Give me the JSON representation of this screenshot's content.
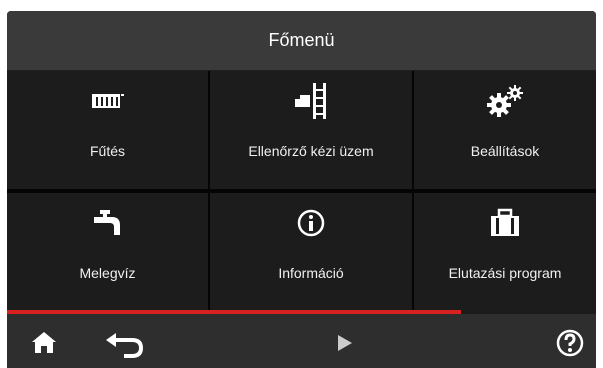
{
  "header": {
    "title": "Főmenü"
  },
  "menu": {
    "items": [
      {
        "label": "Fűtés",
        "icon": "radiator-icon"
      },
      {
        "label": "Ellenőrző kézi üzem",
        "icon": "ladder-icon"
      },
      {
        "label": "Beállítások",
        "icon": "gears-icon"
      },
      {
        "label": "Melegvíz",
        "icon": "faucet-icon"
      },
      {
        "label": "Információ",
        "icon": "info-icon"
      },
      {
        "label": "Elutazási program",
        "icon": "suitcase-icon"
      }
    ]
  },
  "progress": {
    "fraction": 0.77,
    "color": "#d82020"
  },
  "footer": {
    "home": "home-icon",
    "back": "back-arrow-icon",
    "play": "play-icon",
    "help": "help-icon"
  },
  "colors": {
    "background": "#1f1f1f",
    "title_bar": "#3a3a3a",
    "accent": "#d82020",
    "text": "#ffffff"
  }
}
